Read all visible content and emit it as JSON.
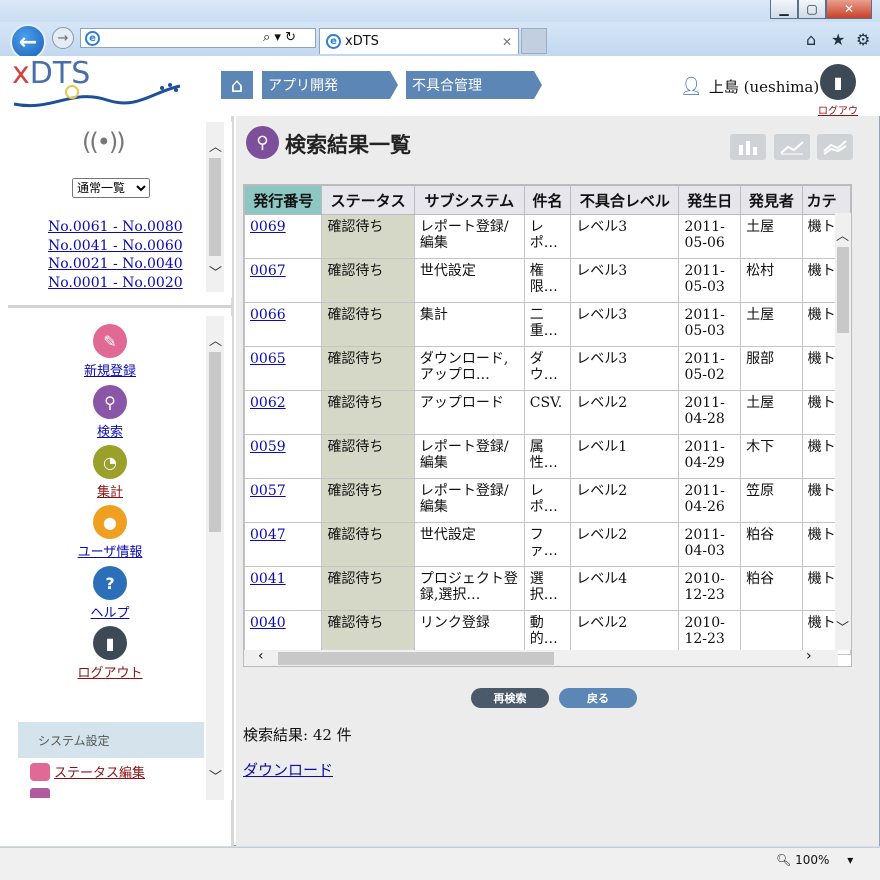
{
  "browser": {
    "tab_title": "xDTS",
    "zoom": "100%"
  },
  "header": {
    "logo": "xDTS",
    "breadcrumbs": [
      "アプリ開発",
      "不具合管理"
    ],
    "user_name": "上島 (ueshima)",
    "logout_label": "ログアウト"
  },
  "sidebar": {
    "view_select": "通常一覧",
    "ranges": [
      "No.0061 - No.0080",
      "No.0041 - No.0060",
      "No.0021 - No.0040",
      "No.0001 - No.0020"
    ],
    "nav": [
      {
        "label": "新規登録",
        "icon": "edit-icon",
        "color": "#e06a93"
      },
      {
        "label": "検索",
        "icon": "search-icon",
        "color": "#8a56a8"
      },
      {
        "label": "集計",
        "icon": "chart-icon",
        "color": "#9aa02a"
      },
      {
        "label": "ユーザ情報",
        "icon": "user-icon",
        "color": "#f0a020"
      },
      {
        "label": "ヘルプ",
        "icon": "help-icon",
        "color": "#2b6fb8"
      },
      {
        "label": "ログアウト",
        "icon": "logout-icon",
        "color": "#3d4a55"
      }
    ],
    "system_section": "システム設定",
    "system_items": [
      "ステータス編集"
    ]
  },
  "main": {
    "title": "検索結果一覧",
    "columns": [
      "発行番号",
      "ステータス",
      "サブシステム",
      "件名",
      "不具合レベル",
      "発生日",
      "発見者",
      "カテ"
    ],
    "rows": [
      [
        "0069",
        "確認待ち",
        "レポート登録/編集",
        "レポ…",
        "レベル3",
        "2011-05-06",
        "土屋",
        "機ト"
      ],
      [
        "0067",
        "確認待ち",
        "世代設定",
        "権限…",
        "レベル3",
        "2011-05-03",
        "松村",
        "機ト"
      ],
      [
        "0066",
        "確認待ち",
        "集計",
        "二重…",
        "レベル3",
        "2011-05-03",
        "土屋",
        "機ト"
      ],
      [
        "0065",
        "確認待ち",
        "ダウンロード,アップロ…",
        "ダウ…",
        "レベル3",
        "2011-05-02",
        "服部",
        "機ト"
      ],
      [
        "0062",
        "確認待ち",
        "アップロード",
        "CSV.",
        "レベル2",
        "2011-04-28",
        "土屋",
        "機ト"
      ],
      [
        "0059",
        "確認待ち",
        "レポート登録/編集",
        "属性…",
        "レベル1",
        "2011-04-29",
        "木下",
        "機ト"
      ],
      [
        "0057",
        "確認待ち",
        "レポート登録/編集",
        "レポ…",
        "レベル2",
        "2011-04-26",
        "笠原",
        "機ト"
      ],
      [
        "0047",
        "確認待ち",
        "世代設定",
        "ファ…",
        "レベル2",
        "2011-04-03",
        "粕谷",
        "機ト"
      ],
      [
        "0041",
        "確認待ち",
        "プロジェクト登録,選択…",
        "選択…",
        "レベル4",
        "2010-12-23",
        "粕谷",
        "機ト"
      ],
      [
        "0040",
        "確認待ち",
        "リンク登録",
        "動的…",
        "レベル2",
        "2010-12-23",
        "",
        "機ト"
      ]
    ],
    "research_button": "再検索",
    "back_button": "戻る",
    "count_text": "検索結果: 42 件",
    "download_link": "ダウンロード"
  }
}
